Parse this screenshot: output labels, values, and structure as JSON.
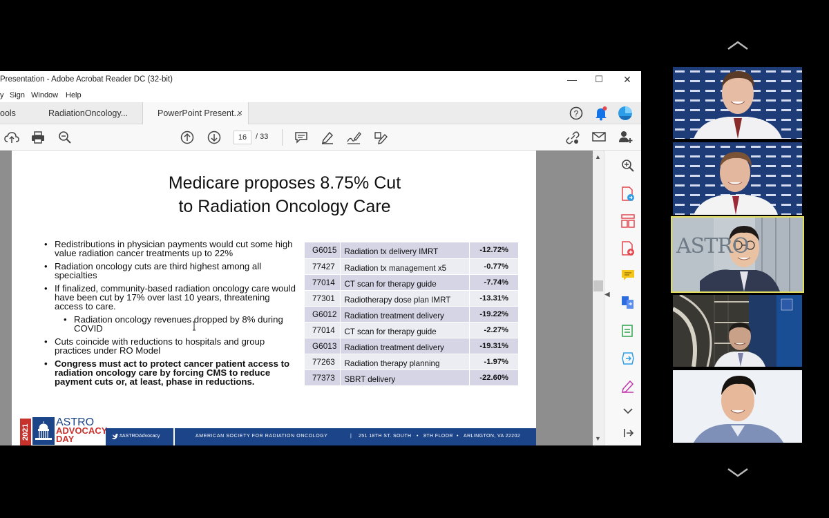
{
  "window": {
    "title": "Presentation - Adobe Acrobat Reader DC (32-bit)",
    "controls": {
      "minimize": "—",
      "maximize": "☐",
      "close": "✕"
    }
  },
  "menu": [
    "y",
    "Sign",
    "Window",
    "Help"
  ],
  "tabs": [
    {
      "label": "ools"
    },
    {
      "label": "RadiationOncology..."
    },
    {
      "label": "PowerPoint Present...",
      "active": true,
      "close": "×"
    }
  ],
  "toolbar": {
    "page_current": "16",
    "page_total": "/  33",
    "icons": [
      "upload-icon",
      "print-icon",
      "zoom-out-icon",
      "page-up-icon",
      "page-down-icon",
      "comment-icon",
      "highlight-icon",
      "sign-icon",
      "edit-icon",
      "link-icon",
      "mail-icon",
      "add-user-icon"
    ]
  },
  "header_icons": [
    "help-icon",
    "notification-icon",
    "profile-icon"
  ],
  "right_panel_icons": [
    "zoom-icon",
    "export-pdf-icon",
    "organize-icon",
    "create-pdf-icon",
    "comment-tool-icon",
    "combine-icon",
    "compress-icon",
    "send-icon",
    "fill-sign-icon",
    "chevron-down-icon",
    "expand-icon"
  ],
  "slide": {
    "title_line1": "Medicare proposes 8.75% Cut",
    "title_line2": "to Radiation Oncology Care",
    "bullets": [
      {
        "text": "Redistributions in physician payments would cut some high value radiation cancer treatments up to 22%",
        "level": 1
      },
      {
        "text": "Radiation oncology cuts are third highest among all specialties",
        "level": 1
      },
      {
        "text": "If finalized, community-based radiation oncology care would have been cut by 17% over last 10 years, threatening access to care.",
        "level": 1
      },
      {
        "text": "Radiation oncology revenues dropped by 8% during COVID",
        "level": 2
      },
      {
        "text": "Cuts coincide with reductions to hospitals and group practices under RO Model",
        "level": 1
      },
      {
        "text": "Congress must act to protect cancer patient access to radiation oncology care by forcing CMS to reduce payment cuts or, at least, phase in reductions.",
        "level": 1,
        "bold": true
      }
    ],
    "table": [
      {
        "code": "G6015",
        "desc": "Radiation tx delivery IMRT",
        "pct": "-12.72%"
      },
      {
        "code": "77427",
        "desc": "Radiation tx management x5",
        "pct": "-0.77%"
      },
      {
        "code": "77014",
        "desc": "CT scan for therapy guide",
        "pct": "-7.74%"
      },
      {
        "code": "77301",
        "desc": "Radiotherapy dose plan IMRT",
        "pct": "-13.31%"
      },
      {
        "code": "G6012",
        "desc": "Radiation treatment delivery",
        "pct": "-19.22%"
      },
      {
        "code": "77014",
        "desc": "CT scan for therapy guide",
        "pct": "-2.27%"
      },
      {
        "code": "G6013",
        "desc": "Radiation treatment delivery",
        "pct": "-19.31%"
      },
      {
        "code": "77263",
        "desc": "Radiation therapy planning",
        "pct": "-1.97%"
      },
      {
        "code": "77373",
        "desc": "SBRT delivery",
        "pct": "-22.60%"
      }
    ],
    "footer": {
      "year": "2021",
      "brand_line1": "ASTRO",
      "brand_line2": "ADVOCACY",
      "brand_line3": "DAY",
      "twitter": "#ASTROAdvocacy",
      "org": "AMERICAN SOCIETY FOR RADIATION ONCOLOGY",
      "address1": "251 18TH ST. SOUTH",
      "address2": "8TH FLOOR",
      "address3": "ARLINGTON, VA 22202"
    }
  },
  "video": {
    "tile3_logo": "ASTRO",
    "colors": {
      "highlight": "#e2de5f",
      "brand_blue": "#1b4489",
      "brand_red": "#c8322d"
    }
  }
}
